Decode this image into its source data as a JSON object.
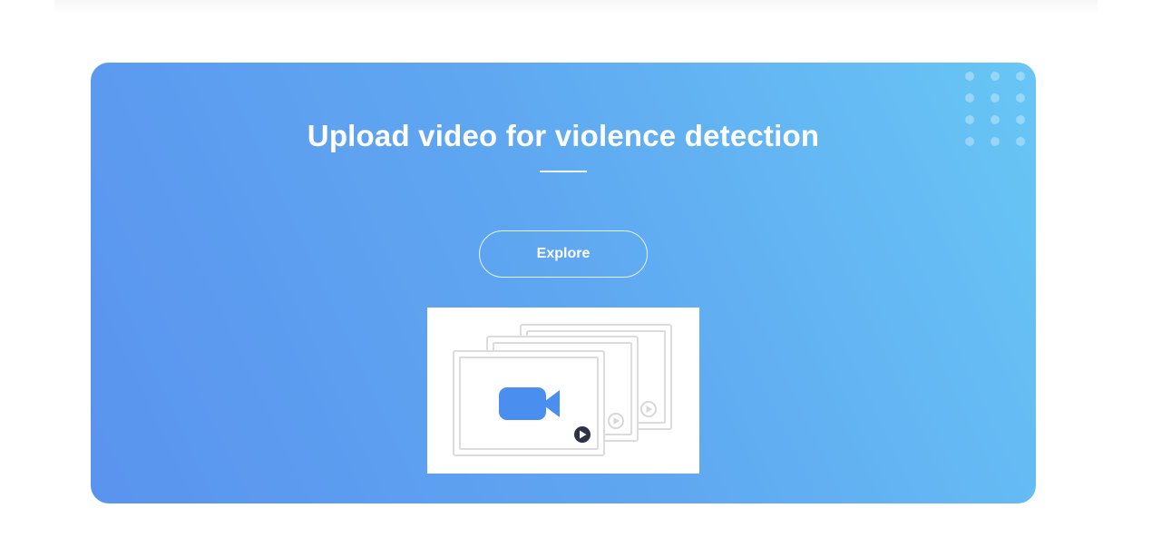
{
  "hero": {
    "title": "Upload video for violence detection",
    "explore_label": "Explore"
  },
  "illustration": {
    "icons": [
      "video-camera-icon",
      "play-icon"
    ]
  },
  "colors": {
    "gradient_start": "#5a93ee",
    "gradient_end": "#68c6f5",
    "camera": "#4a8ef0",
    "play_active": "#2f3147",
    "frame_stroke": "#dcdcdc"
  }
}
